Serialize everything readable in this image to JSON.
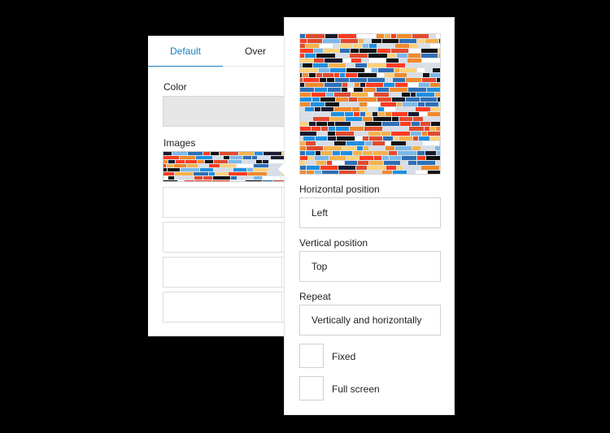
{
  "tabs": [
    {
      "label": "Default",
      "active": true
    },
    {
      "label": "Over",
      "active": false
    }
  ],
  "background_panel": {
    "color_label": "Color",
    "color_value": "#e6e6e6",
    "images_label": "Images"
  },
  "image_settings": {
    "horizontal_position": {
      "label": "Horizontal position",
      "value": "Left"
    },
    "vertical_position": {
      "label": "Vertical position",
      "value": "Top"
    },
    "repeat": {
      "label": "Repeat",
      "value": "Vertically and horizontally"
    },
    "fixed": {
      "label": "Fixed",
      "checked": false
    },
    "full_screen": {
      "label": "Full screen",
      "checked": false
    }
  },
  "image_palette": [
    "#ff3b1f",
    "#1f8fe0",
    "#ffffff",
    "#111111",
    "#f5b24a",
    "#ffd27a",
    "#2e6fb5",
    "#d8dde6",
    "#e24a2c",
    "#7bb8e8",
    "#1a1a2e",
    "#f08a2c"
  ],
  "icons": {
    "pointer": "popover-caret"
  }
}
